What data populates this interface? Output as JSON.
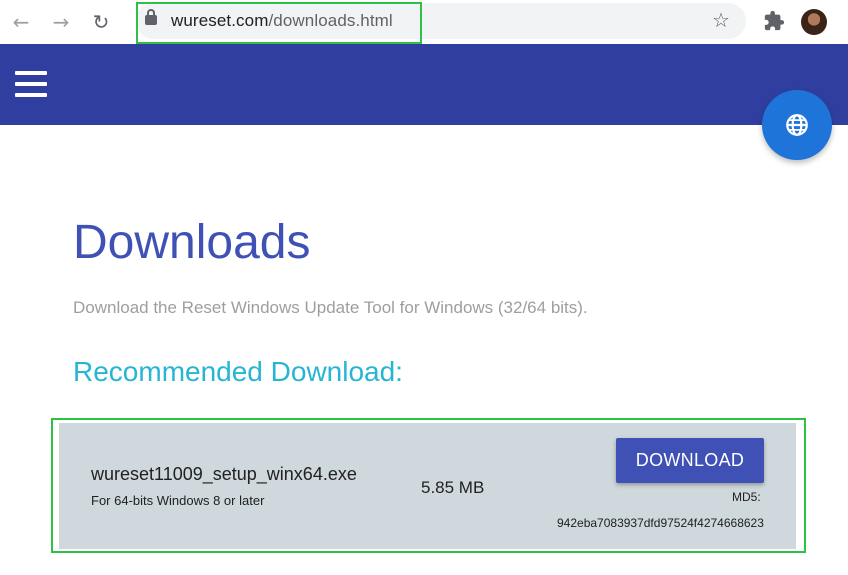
{
  "browser": {
    "url_domain": "wureset.com",
    "url_path": "/downloads.html",
    "back_icon": "arrow-left-icon",
    "forward_icon": "arrow-right-icon",
    "reload_icon": "reload-icon",
    "bookmark_icon": "star-icon",
    "extensions_icon": "puzzle-icon"
  },
  "header": {
    "menu_icon": "hamburger-icon",
    "language_icon": "globe-icon",
    "color": "#303f9f"
  },
  "main": {
    "title": "Downloads",
    "subtitle": "Download the Reset Windows Update Tool for Windows (32/64 bits).",
    "section_title": "Recommended Download:"
  },
  "download": {
    "file_name": "wureset11009_setup_winx64.exe",
    "requirements": "For 64-bits Windows 8 or later",
    "size": "5.85 MB",
    "button_label": "DOWNLOAD",
    "md5_label": "MD5:",
    "md5_value": "942eba7083937dfd97524f4274668623"
  },
  "colors": {
    "accent": "#3f51b5",
    "section": "#26b5d3",
    "highlight": "#2fc147",
    "row_bg": "#cfd8dc"
  }
}
